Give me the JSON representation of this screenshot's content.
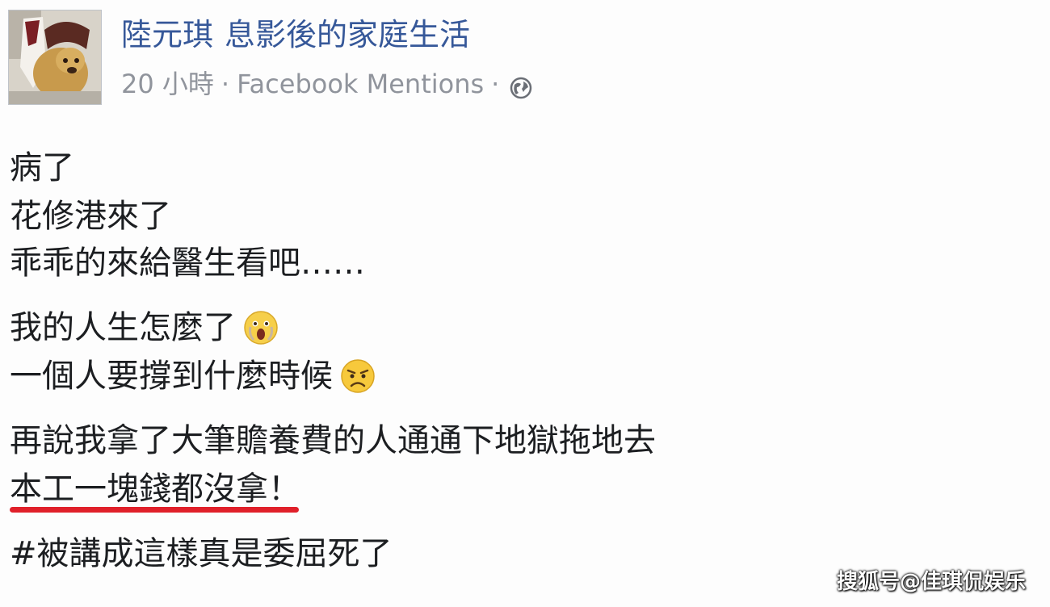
{
  "post": {
    "author": "陸元琪",
    "group": "息影後的家庭生活",
    "timestamp": "20 小時",
    "separator": "·",
    "source": "Facebook Mentions",
    "privacy_icon": "globe-icon",
    "lines": [
      "病了",
      "花修港來了",
      "乖乖的來給醫生看吧……",
      "我的人生怎麼了",
      "一個人要撐到什麼時候",
      "再說我拿了大筆贍養費的人通通下地獄拖地去",
      "本工一塊錢都沒拿！",
      "#被講成這樣真是委屈死了"
    ],
    "emojis": [
      "shocked-face-emoji",
      "worried-face-emoji"
    ]
  },
  "annotation": {
    "underline_color": "#e0202a"
  },
  "watermark": "搜狐号@佳琪侃娱乐"
}
